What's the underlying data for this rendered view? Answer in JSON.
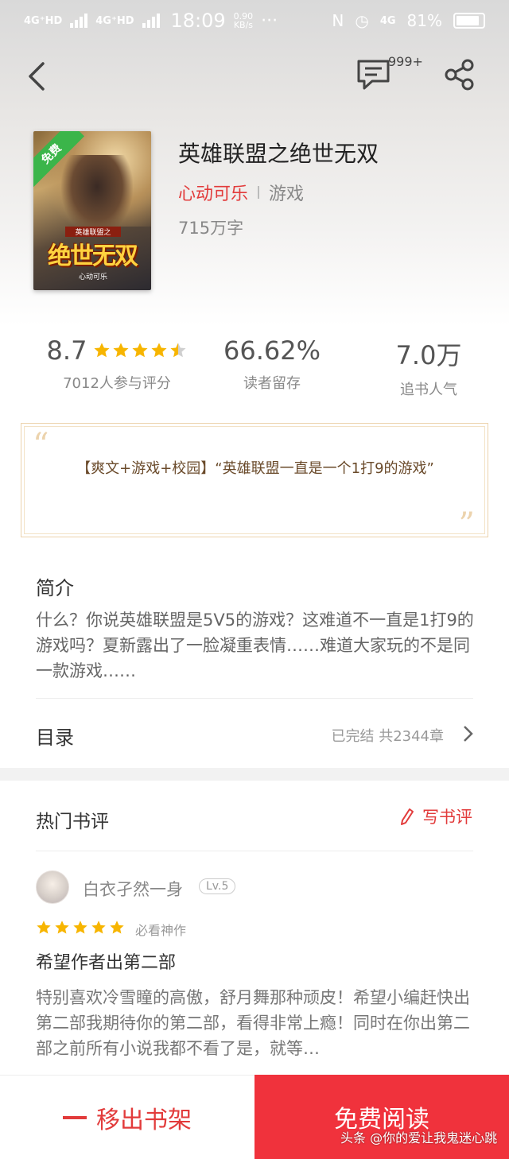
{
  "status_bar": {
    "signal1": "4G⁺HD",
    "signal2": "4G⁺HD",
    "time": "18:09",
    "speed_value": "0.90",
    "speed_unit": "KB/s",
    "network": "4G",
    "battery": "81%"
  },
  "nav": {
    "comment_count": "999+"
  },
  "book": {
    "title": "英雄联盟之绝世无双",
    "author": "心动可乐",
    "genre": "游戏",
    "word_count": "715万字",
    "cover_badge": "免费",
    "cover_title": "绝世无双",
    "cover_subtitle": "英雄联盟之",
    "cover_author": "心动可乐"
  },
  "stats": {
    "rating": "8.7",
    "rating_stars": 4.5,
    "rating_label": "7012人参与评分",
    "retention": "66.62%",
    "retention_label": "读者留存",
    "popularity": "7.0万",
    "popularity_label": "追书人气"
  },
  "quote": {
    "text": "【爽文+游戏+校园】“英雄联盟一直是一个1打9的游戏”"
  },
  "intro": {
    "title": "简介",
    "text": "什么？你说英雄联盟是5V5的游戏？这难道不一直是1打9的游戏吗？夏新露出了一脸凝重表情……难道大家玩的不是同一款游戏……"
  },
  "toc": {
    "title": "目录",
    "status": "已完结  共2344章"
  },
  "reviews": {
    "title": "热门书评",
    "write_label": "写书评",
    "items": [
      {
        "username": "白衣孑然一身",
        "level": "Lv.5",
        "stars": 5,
        "tag": "必看神作",
        "heading": "希望作者出第二部",
        "body": "特别喜欢冷雪瞳的高傲，舒月舞那种顽皮！希望小编赶快出第二部我期待你的第二部，看得非常上瘾！同时在你出第二部之前所有小说我都不看了是，就等…"
      }
    ]
  },
  "bottom": {
    "remove_label": "移出书架",
    "read_label": "免费阅读"
  },
  "watermark": "头条 @你的爱让我鬼迷心跳",
  "colors": {
    "accent": "#e23b3b",
    "read_button": "#f0323c",
    "star": "#f7b500"
  }
}
